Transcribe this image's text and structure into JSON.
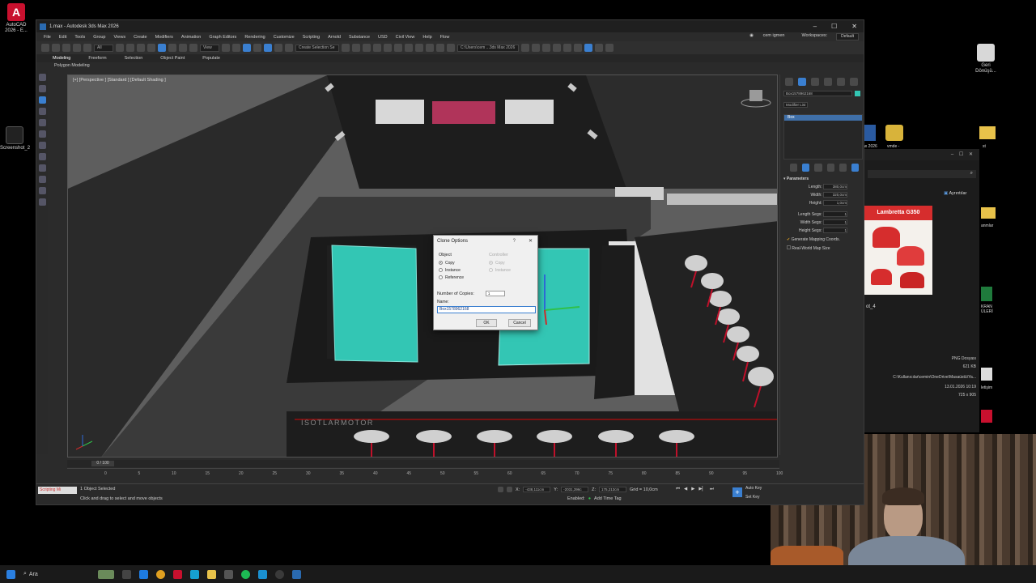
{
  "window": {
    "title": "1.max - Autodesk 3ds Max 2026",
    "controls": [
      "–",
      "☐",
      "✕"
    ]
  },
  "menu": {
    "items": [
      "File",
      "Edit",
      "Tools",
      "Group",
      "Views",
      "Create",
      "Modifiers",
      "Animation",
      "Graph Editors",
      "Rendering",
      "Customize",
      "Scripting",
      "Arnold",
      "Substance",
      "USD",
      "Civil View",
      "Help",
      "Flow"
    ],
    "user": "cem igmen",
    "workspaces_label": "Workspaces:",
    "workspaces_value": "Default"
  },
  "toolbar": {
    "filter_value": "All",
    "view_value": "View",
    "selection_set_value": "Create Selection Se",
    "path_value": "C:\\Users\\cem ...3ds Max 2026"
  },
  "ribbon": {
    "tabs": [
      "Modeling",
      "Freeform",
      "Selection",
      "Object Paint",
      "Populate"
    ],
    "sub_label": "Polygon Modeling"
  },
  "viewport": {
    "label": "[+] [Perspective ] [Standard ] [Default Shading ]",
    "brand_text": "ISOTLARMOTOR"
  },
  "clone_dialog": {
    "title": "Clone Options",
    "help": "?",
    "close": "✕",
    "object_group": "Object",
    "controller_group": "Controller",
    "object_options": [
      "Copy",
      "Instance",
      "Reference"
    ],
    "controller_options": [
      "Copy",
      "Instance"
    ],
    "copies_label": "Number of Copies:",
    "copies_value": "1",
    "name_label": "Name:",
    "name_value": "Box1578962168",
    "ok": "OK",
    "cancel": "Cancel"
  },
  "command_panel": {
    "object_name": "Box1578962168",
    "modifier_list": "Modifier List",
    "stack_item": "Box",
    "parameters_title": "Parameters",
    "params": [
      {
        "label": "Length:",
        "value": "380,0cm"
      },
      {
        "label": "Width:",
        "value": "320,0cm"
      },
      {
        "label": "Height:",
        "value": "1,0cm"
      },
      {
        "label": "Length Segs:",
        "value": "1"
      },
      {
        "label": "Width Segs:",
        "value": "1"
      },
      {
        "label": "Height Segs:",
        "value": "1"
      }
    ],
    "checks": [
      {
        "label": "Generate Mapping Coords.",
        "checked": true
      },
      {
        "label": "Real-World Map Size",
        "checked": false
      }
    ]
  },
  "timeline": {
    "frame_display": "0 / 100",
    "ticks": [
      "0",
      "5",
      "10",
      "15",
      "20",
      "25",
      "30",
      "35",
      "40",
      "45",
      "50",
      "55",
      "60",
      "65",
      "70",
      "75",
      "80",
      "85",
      "90",
      "95",
      "100"
    ]
  },
  "status": {
    "maxscript_label": "Scripting Mi",
    "selected": "1 Object Selected",
    "hint": "Click and drag to select and move objects",
    "x_label": "X:",
    "x_value": "-438,111cm",
    "y_label": "Y:",
    "y_value": "-2031,396c",
    "z_label": "Z:",
    "z_value": "175,213cm",
    "grid": "Grid = 10,0cm",
    "enabled": "Enabled:",
    "add_time_tag": "Add Time Tag",
    "auto_key": "Auto Key",
    "selected_dd": "Selected",
    "set_key": "Set Key",
    "key_filters": "Key Filters..."
  },
  "desktop_icons": [
    {
      "label": "AutoCAD 2026 - E...",
      "color": "#c8102e"
    },
    {
      "label": "Screenshot_2",
      "color": "#222"
    },
    {
      "label": "Geri Dönüşü...",
      "color": "#eee"
    }
  ],
  "explorer": {
    "details_label": "Ayrıntılar",
    "file_name": "ot_4",
    "poster_title": "Lambretta G350",
    "file_type": "PNG Dosyası",
    "file_size": "621 KB",
    "file_path": "C:\\Kullanıcılar\\cemin\\OneDrive\\Masaüstü\\Ya...",
    "file_date": "13.01.2026 10:19",
    "file_dims": "725 x 905"
  },
  "right_desktop": {
    "labels": [
      "ax 2026",
      "vmde -",
      "st",
      "anmlar",
      "KRAN ÜLERİ",
      "letişim"
    ]
  },
  "taskbar": {
    "search": "Ara"
  }
}
